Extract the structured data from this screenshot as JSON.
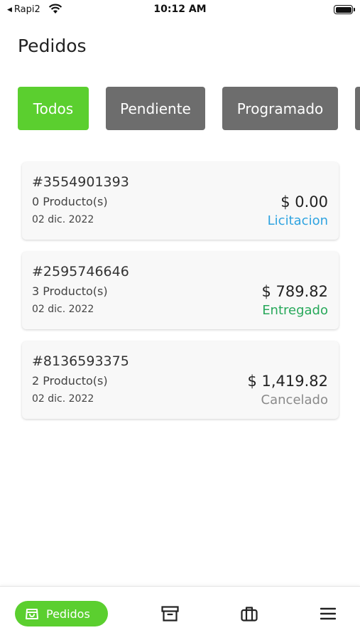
{
  "status_bar": {
    "back_label": "Rapi2",
    "time": "10:12 AM"
  },
  "page": {
    "title": "Pedidos"
  },
  "tabs": [
    {
      "label": "Todos",
      "active": true
    },
    {
      "label": "Pendiente",
      "active": false
    },
    {
      "label": "Programado",
      "active": false
    }
  ],
  "orders": [
    {
      "id": "#3554901393",
      "products": "0 Producto(s)",
      "date": "02 dic. 2022",
      "price": "$ 0.00",
      "status": "Licitacion",
      "status_color": "#2ea3e0"
    },
    {
      "id": "#2595746646",
      "products": "3 Producto(s)",
      "date": "02 dic. 2022",
      "price": "$ 789.82",
      "status": "Entregado",
      "status_color": "#27a85a"
    },
    {
      "id": "#8136593375",
      "products": "2 Producto(s)",
      "date": "02 dic. 2022",
      "price": "$ 1,419.82",
      "status": "Cancelado",
      "status_color": "#8a8a8a"
    }
  ],
  "bottom_nav": {
    "active_label": "Pedidos",
    "icons": [
      "shopping-bag-icon",
      "archive-box-icon",
      "briefcase-icon",
      "menu-icon"
    ]
  },
  "colors": {
    "accent": "#5bcf2f",
    "tab_inactive": "#6d6d6d"
  }
}
